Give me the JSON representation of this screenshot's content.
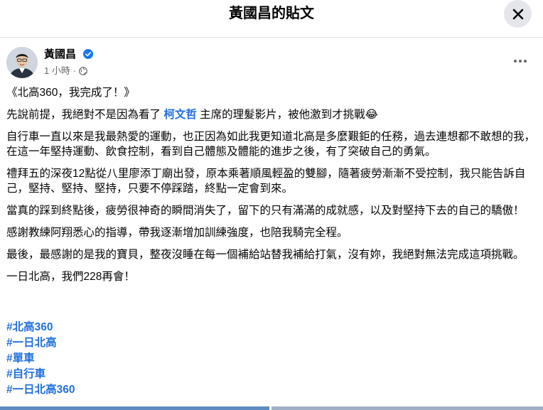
{
  "header": {
    "title": "黃國昌的貼文",
    "close_icon": "close-icon"
  },
  "post": {
    "author": "黃國昌",
    "verified_icon": "verified-badge-icon",
    "time": "1 小時",
    "separator": "·",
    "privacy_icon": "globe-icon",
    "more_icon": "more-options-icon",
    "paragraphs": {
      "p1": "《北高360，我完成了！》",
      "p2_before": "先說前提，我絕對不是因為看了 ",
      "p2_mention": "柯文哲",
      "p2_after": " 主席的理髮影片，被他激到才挑戰😂",
      "p3": "自行車一直以來是我最熱愛的運動，也正因為如此我更知道北高是多麼艱鉅的任務，過去連想都不敢想的我，在這一年堅持運動、飲食控制，看到自己體態及體能的進步之後，有了突破自己的勇氣。",
      "p4": "禮拜五的深夜12點從八里廖添丁廟出發，原本乘著順風輕盈的雙腳，隨著疲勞漸漸不受控制，我只能告訴自己，堅持、堅持、堅持，只要不停踩踏，終點一定會到來。",
      "p5": "當真的踩到終點後，疲勞很神奇的瞬間消失了，留下的只有滿滿的成就感，以及對堅持下去的自己的驕傲！",
      "p6": "感謝教練阿翔悉心的指導，帶我逐漸增加訓練強度，也陪我騎完全程。",
      "p7": "最後，最感謝的是我的寶貝，整夜沒睡在每一個補給站替我補給打氣，沒有妳，我絕對無法完成這項挑戰。",
      "p8": "一日北高，我們228再會！"
    },
    "hashtags": [
      "#北高360",
      "#一日北高",
      "#單車",
      "#自行車",
      "#一日北高360"
    ]
  },
  "colors": {
    "link": "#216fdb",
    "muted": "#65676b",
    "close_bg": "#e4e6eb"
  }
}
